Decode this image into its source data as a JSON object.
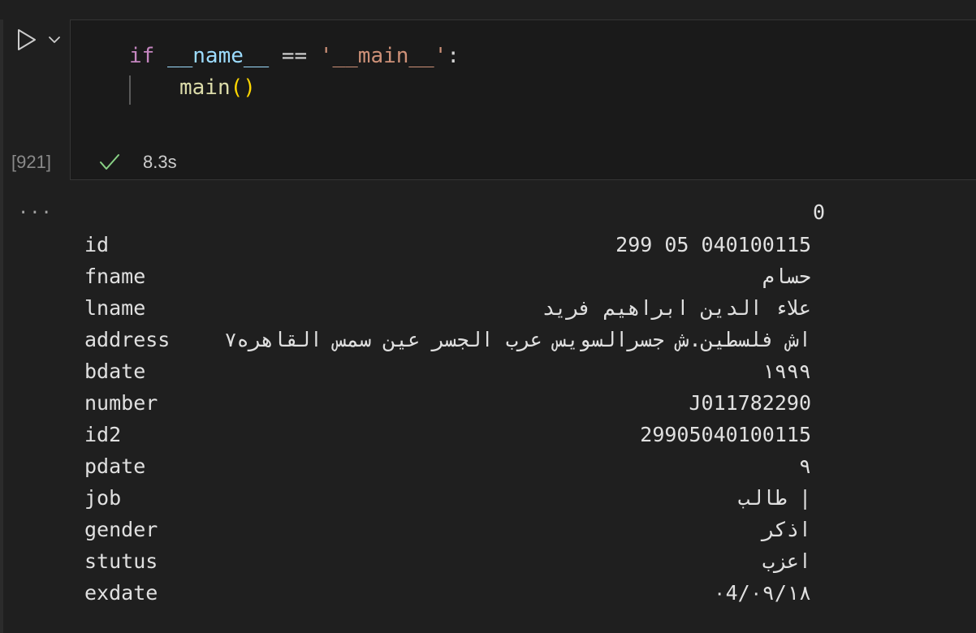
{
  "cell": {
    "code": {
      "line1": {
        "kw": "if",
        "space1": " ",
        "ident": "__name__",
        "op": " == ",
        "str": "'__main__'",
        "colon": ":"
      },
      "line2": {
        "fn": "main",
        "paren": "()"
      }
    },
    "execution_count": "[921]",
    "exec_time": "8.3s",
    "status": "success"
  },
  "output": {
    "menu_label": "...",
    "column_header": "0",
    "rows": [
      {
        "key": "id",
        "value": "299 05 040100115"
      },
      {
        "key": "fname",
        "value": "حسام"
      },
      {
        "key": "lname",
        "value": "علاء الدين ابراهيم فريد"
      },
      {
        "key": "address",
        "value": "اش فلسطين.ش جسرالسويس عرب الجسر عين سمس القاهره٧"
      },
      {
        "key": "bdate",
        "value": "١٩٩٩"
      },
      {
        "key": "number",
        "value": "J011782290"
      },
      {
        "key": "id2",
        "value": "29905040100115"
      },
      {
        "key": "pdate",
        "value": "٩"
      },
      {
        "key": "job",
        "value": "طالب |"
      },
      {
        "key": "gender",
        "value": "اذكر"
      },
      {
        "key": "stutus",
        "value": "اعزب"
      },
      {
        "key": "exdate",
        "value": "٠4/٠٩/١٨"
      }
    ]
  },
  "icons": {
    "run": "play-icon",
    "run_options": "chevron-down-icon",
    "status": "checkmark-icon"
  },
  "colors": {
    "background": "#1f1f1f",
    "editor_background": "#1a1a1a",
    "keyword": "#c586c0",
    "identifier": "#9cdcfe",
    "string": "#ce9178",
    "function": "#dcdcaa",
    "bracket": "#ffd700",
    "success": "#89d185",
    "text": "#e0e0e0"
  }
}
